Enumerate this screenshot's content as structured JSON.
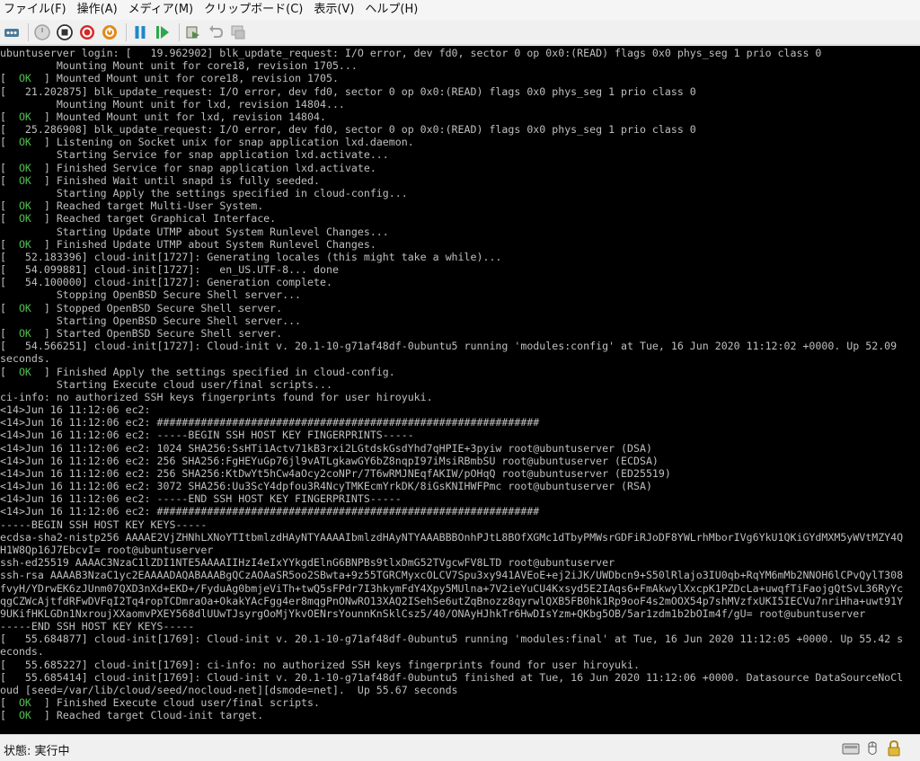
{
  "menu": [
    "ファイル(F)",
    "操作(A)",
    "メディア(M)",
    "クリップボード(C)",
    "表示(V)",
    "ヘルプ(H)"
  ],
  "toolbar": {
    "buttons": [
      {
        "name": "ctrl-alt-del-icon",
        "color": "#4a7a9a"
      },
      {
        "name": "start-icon",
        "color": "#a0a0a0"
      },
      {
        "name": "turn-off-icon",
        "color": "#333333"
      },
      {
        "name": "shutdown-icon",
        "color": "#d42a2a"
      },
      {
        "name": "save-state-icon",
        "color": "#e08a1a"
      },
      {
        "name": "pause-icon",
        "color": "#1e88c8"
      },
      {
        "name": "reset-icon",
        "color": "#2aa84a"
      },
      {
        "name": "checkpoint-icon",
        "color": "#5a8a4a"
      },
      {
        "name": "revert-icon",
        "color": "#a0a0a0"
      },
      {
        "name": "enhanced-session-icon",
        "color": "#a0a0a0"
      }
    ]
  },
  "console": {
    "lines": [
      {
        "t": "ubuntuserver login: [   19.962902] blk_update_request: I/O error, dev fd0, sector 0 op 0x0:(READ) flags 0x0 phys_seg 1 prio class 0"
      },
      {
        "t": "         Mounting Mount unit for core18, revision 1705..."
      },
      {
        "ok": true,
        "t": " Mounted Mount unit for core18, revision 1705."
      },
      {
        "t": "[   21.202875] blk_update_request: I/O error, dev fd0, sector 0 op 0x0:(READ) flags 0x0 phys_seg 1 prio class 0"
      },
      {
        "t": "         Mounting Mount unit for lxd, revision 14804..."
      },
      {
        "ok": true,
        "t": " Mounted Mount unit for lxd, revision 14804."
      },
      {
        "t": "[   25.286908] blk_update_request: I/O error, dev fd0, sector 0 op 0x0:(READ) flags 0x0 phys_seg 1 prio class 0"
      },
      {
        "ok": true,
        "t": " Listening on Socket unix for snap application lxd.daemon."
      },
      {
        "t": "         Starting Service for snap application lxd.activate..."
      },
      {
        "ok": true,
        "t": " Finished Service for snap application lxd.activate."
      },
      {
        "ok": true,
        "t": " Finished Wait until snapd is fully seeded."
      },
      {
        "t": "         Starting Apply the settings specified in cloud-config..."
      },
      {
        "ok": true,
        "t": " Reached target Multi-User System."
      },
      {
        "ok": true,
        "t": " Reached target Graphical Interface."
      },
      {
        "t": "         Starting Update UTMP about System Runlevel Changes..."
      },
      {
        "ok": true,
        "t": " Finished Update UTMP about System Runlevel Changes."
      },
      {
        "t": "[   52.183396] cloud-init[1727]: Generating locales (this might take a while)..."
      },
      {
        "t": "[   54.099881] cloud-init[1727]:   en_US.UTF-8... done"
      },
      {
        "t": "[   54.100000] cloud-init[1727]: Generation complete."
      },
      {
        "t": "         Stopping OpenBSD Secure Shell server..."
      },
      {
        "ok": true,
        "t": " Stopped OpenBSD Secure Shell server."
      },
      {
        "t": "         Starting OpenBSD Secure Shell server..."
      },
      {
        "ok": true,
        "t": " Started OpenBSD Secure Shell server."
      },
      {
        "t": "[   54.566251] cloud-init[1727]: Cloud-init v. 20.1-10-g71af48df-0ubuntu5 running 'modules:config' at Tue, 16 Jun 2020 11:12:02 +0000. Up 52.09"
      },
      {
        "t": "seconds."
      },
      {
        "ok": true,
        "t": " Finished Apply the settings specified in cloud-config."
      },
      {
        "t": "         Starting Execute cloud user/final scripts..."
      },
      {
        "t": "ci-info: no authorized SSH keys fingerprints found for user hiroyuki."
      },
      {
        "t": "<14>Jun 16 11:12:06 ec2:"
      },
      {
        "t": "<14>Jun 16 11:12:06 ec2: #############################################################"
      },
      {
        "t": "<14>Jun 16 11:12:06 ec2: -----BEGIN SSH HOST KEY FINGERPRINTS-----"
      },
      {
        "t": "<14>Jun 16 11:12:06 ec2: 1024 SHA256:SsHTi1Actv71kB3rxi2LGtdskGsdYhd7qHPIE+3pyiw root@ubuntuserver (DSA)"
      },
      {
        "t": "<14>Jun 16 11:12:06 ec2: 256 SHA256:FgHEYuGp76jl9vATLgkawGY6bZ8nqpI97iMsiRBmbSU root@ubuntuserver (ECDSA)"
      },
      {
        "t": "<14>Jun 16 11:12:06 ec2: 256 SHA256:KtDwYt5hCw4aOcy2coNPr/7T6wRMJNEqfAKIW/pOHqQ root@ubuntuserver (ED25519)"
      },
      {
        "t": "<14>Jun 16 11:12:06 ec2: 3072 SHA256:Uu3ScY4dpfou3R4NcyTMKEcmYrkDK/8iGsKNIHWFPmc root@ubuntuserver (RSA)"
      },
      {
        "t": "<14>Jun 16 11:12:06 ec2: -----END SSH HOST KEY FINGERPRINTS-----"
      },
      {
        "t": "<14>Jun 16 11:12:06 ec2: #############################################################"
      },
      {
        "t": "-----BEGIN SSH HOST KEY KEYS-----"
      },
      {
        "t": "ecdsa-sha2-nistp256 AAAAE2VjZHNhLXNoYTItbmlzdHAyNTYAAAAIbmlzdHAyNTYAAABBBOnhPJtL8BOfXGMc1dTbyPMWsrGDFiRJoDF8YWLrhMborIVg6YkU1QKiGYdMXM5yWVtMZY4Q"
      },
      {
        "t": "H1W8Qp16J7EbcvI= root@ubuntuserver"
      },
      {
        "t": "ssh-ed25519 AAAAC3NzaC1lZDI1NTE5AAAAIIHzI4eIxYYkgdElnG6BNPBs9tlxDmG52TVgcwFV8LTD root@ubuntuserver"
      },
      {
        "t": "ssh-rsa AAAAB3NzaC1yc2EAAAADAQABAAABgQCzAOAaSR5oo2SBwta+9z55TGRCMyxcOLCV7Spu3xy941AVEoE+ej2iJK/UWDbcn9+S50lRlajo3IU0qb+RqYM6mMb2NNOH6lCPvQylT308"
      },
      {
        "t": "fvyH/YDrwEK6zJUnm07QXD3nXd+EKD+/FyduAg0bmjeViTh+twQ5sFPdr7I3hkymFdY4Xpy5MUlna+7V2ieYuCU4Kxsyd5E2IAqs6+FmAkwylXxcpK1PZDcLa+uwqfTiFaojgQtSvL36RyYc"
      },
      {
        "t": "qgCZWcAjtfdRFwDVFqI2Tq4ropTCDmraOa+OkakYAcFgg4er8mqgPnONwRO13XAQ2ISehSe6utZqBnozz8qyrwlQXB5FB0hk1Rp9ooF4s2mOOX54p7shMVzfxUKI5IECVu7nriHha+uwt91Y"
      },
      {
        "t": "9UKifHKLGDn1NxroujXXaomvPXEY568dlUUwTJsyrgOoMjYkvOENrsYounnKnSklCsz5/40/ONAyHJhkTr6HwDIsYzm+QKbg5OB/5ar1zdm1b2bOIm4f/gU= root@ubuntuserver"
      },
      {
        "t": "-----END SSH HOST KEY KEYS-----"
      },
      {
        "t": "[   55.684877] cloud-init[1769]: Cloud-init v. 20.1-10-g71af48df-0ubuntu5 running 'modules:final' at Tue, 16 Jun 2020 11:12:05 +0000. Up 55.42 s"
      },
      {
        "t": "econds."
      },
      {
        "t": "[   55.685227] cloud-init[1769]: ci-info: no authorized SSH keys fingerprints found for user hiroyuki."
      },
      {
        "t": "[   55.685414] cloud-init[1769]: Cloud-init v. 20.1-10-g71af48df-0ubuntu5 finished at Tue, 16 Jun 2020 11:12:06 +0000. Datasource DataSourceNoCl"
      },
      {
        "t": "oud [seed=/var/lib/cloud/seed/nocloud-net][dsmode=net].  Up 55.67 seconds"
      },
      {
        "ok": true,
        "t": " Finished Execute cloud user/final scripts."
      },
      {
        "ok": true,
        "t": " Reached target Cloud-init target."
      }
    ],
    "ok_label": "  OK  "
  },
  "status": {
    "label": "状態: 実行中",
    "icons": [
      "screen-icon",
      "mouse-icon",
      "lock-icon"
    ]
  }
}
